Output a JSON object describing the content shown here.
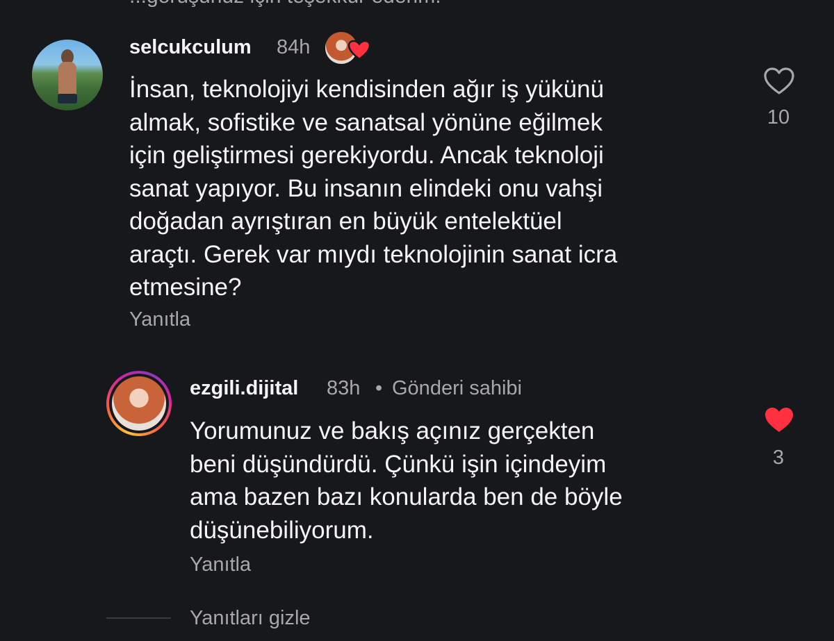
{
  "top_cut_text": "...görüşünüz için teşekkür ederim.",
  "comment": {
    "username": "selcukculum",
    "time": "84h",
    "text": "İnsan, teknolojiyi kendisinden ağır iş yükünü\nalmak, sofistike ve sanatsal yönüne eğilmek\niçin geliştirmesi gerekiyordu. Ancak teknoloji\nsanat yapıyor. Bu insanın elindeki onu vahşi\ndoğadan ayrıştıran en büyük entelektüel\naraçtı. Gerek var mıydı teknolojinin sanat icra\netmesine?",
    "reply_label": "Yanıtla",
    "like_count": "10",
    "liked": false,
    "creator_liked": true
  },
  "reply": {
    "username": "ezgili.dijital",
    "time": "83h",
    "separator": "•",
    "badge": "Gönderi sahibi",
    "text": "Yorumunuz ve bakış açınız gerçekten\nbeni düşündürdü. Çünkü işin içindeyim\nama bazen bazı konularda ben de böyle\ndüşünebiliyorum.",
    "reply_label": "Yanıtla",
    "like_count": "3",
    "liked": true
  },
  "hide_replies_label": "Yanıtları gizle",
  "colors": {
    "background": "#17181b",
    "primary_text": "#f5f5f5",
    "secondary_text": "#a8a8a8",
    "like_red": "#ff3040"
  }
}
